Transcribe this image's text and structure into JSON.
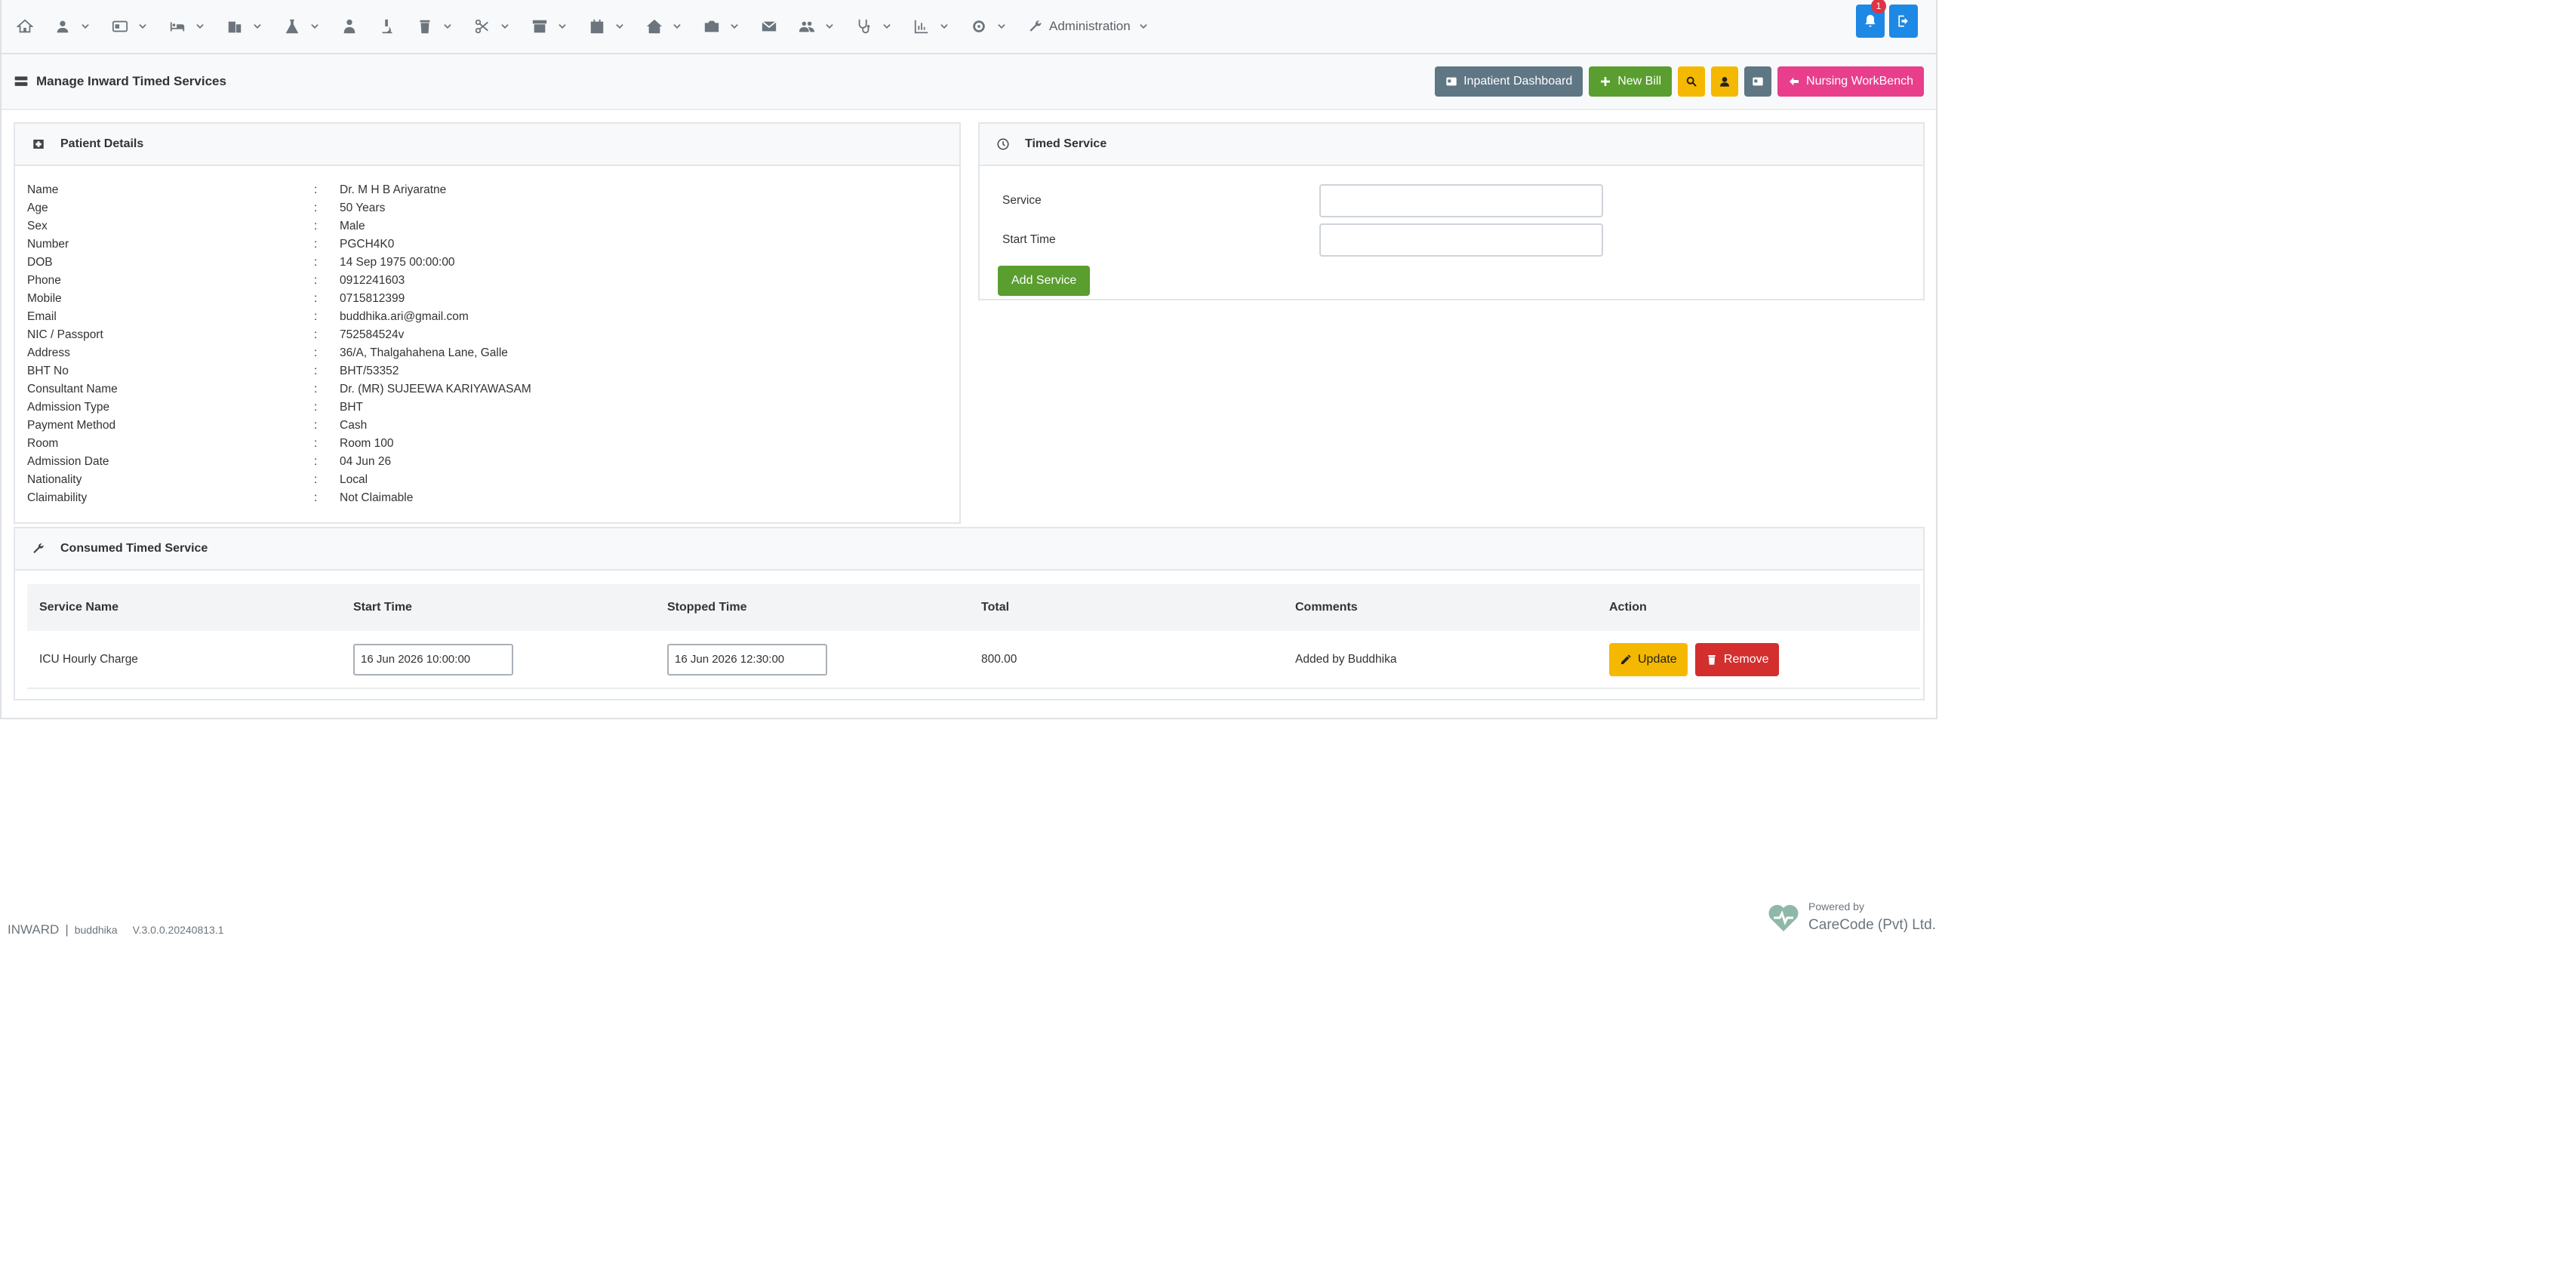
{
  "navbar": {
    "icons": [
      "home-icon",
      "user-icon",
      "id-card-icon",
      "bed-icon",
      "building-icon",
      "flask-icon",
      "doctor-icon",
      "microscope-icon",
      "trash-icon",
      "scissors-icon",
      "archive-icon",
      "calendar-icon",
      "house-medical-icon",
      "camera-icon",
      "envelope-icon",
      "users-icon",
      "stethoscope-icon",
      "chart-icon",
      "gear-icon"
    ],
    "administration_label": "Administration",
    "notification_count": "1"
  },
  "header": {
    "title": "Manage Inward Timed Services",
    "buttons": {
      "inpatient_dashboard": "Inpatient Dashboard",
      "new_bill": "New Bill",
      "nursing_workbench": "Nursing WorkBench"
    }
  },
  "patient": {
    "heading": "Patient Details",
    "fields": [
      {
        "label": "Name",
        "value": "Dr. M H B Ariyaratne"
      },
      {
        "label": "Age",
        "value": "50 Years"
      },
      {
        "label": "Sex",
        "value": "Male"
      },
      {
        "label": "Number",
        "value": "PGCH4K0"
      },
      {
        "label": "DOB",
        "value": "14 Sep 1975 00:00:00"
      },
      {
        "label": "Phone",
        "value": "0912241603"
      },
      {
        "label": "Mobile",
        "value": "0715812399"
      },
      {
        "label": "Email",
        "value": "buddhika.ari@gmail.com"
      },
      {
        "label": "NIC / Passport",
        "value": "752584524v"
      },
      {
        "label": "Address",
        "value": "36/A, Thalgahahena Lane, Galle"
      },
      {
        "label": "BHT No",
        "value": "BHT/53352"
      },
      {
        "label": "Consultant Name",
        "value": "Dr. (MR) SUJEEWA KARIYAWASAM"
      },
      {
        "label": "Admission Type",
        "value": "BHT"
      },
      {
        "label": "Payment Method",
        "value": "Cash"
      },
      {
        "label": "Room",
        "value": "Room 100"
      },
      {
        "label": "Admission Date",
        "value": "04 Jun 26"
      },
      {
        "label": "Nationality",
        "value": "Local"
      },
      {
        "label": "Claimability",
        "value": "Not Claimable"
      }
    ],
    "separator": ":"
  },
  "timed_service": {
    "heading": "Timed Service",
    "service_label": "Service",
    "start_time_label": "Start Time",
    "service_value": "",
    "start_time_value": "",
    "add_button": "Add Service"
  },
  "consumed": {
    "heading": "Consumed Timed Service",
    "columns": [
      "Service Name",
      "Start Time",
      "Stopped Time",
      "Total",
      "Comments",
      "Action"
    ],
    "rows": [
      {
        "service_name": "ICU Hourly Charge",
        "start_time": "16 Jun 2026 10:00:00",
        "stopped_time": "16 Jun 2026 12:30:00",
        "total": "800.00",
        "comments": "Added by Buddhika",
        "update_label": "Update",
        "remove_label": "Remove"
      }
    ]
  },
  "footer": {
    "module": "INWARD",
    "separator": "|",
    "user": "buddhika",
    "version": "V.3.0.0.20240813.1",
    "powered_by": "Powered by",
    "company": "CareCode (Pvt) Ltd."
  }
}
